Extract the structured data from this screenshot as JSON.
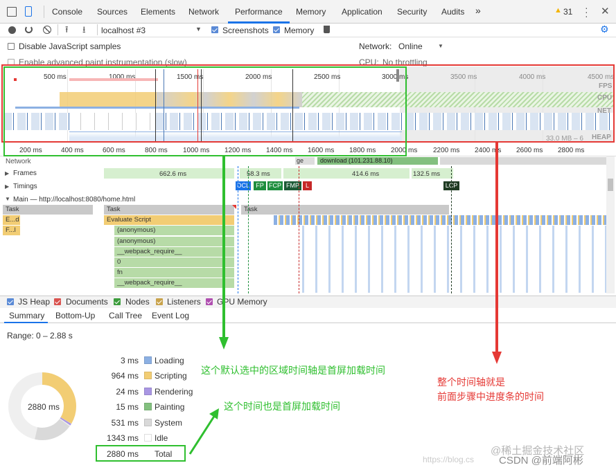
{
  "tabs": {
    "console": "Console",
    "sources": "Sources",
    "elements": "Elements",
    "network": "Network",
    "performance": "Performance",
    "memory": "Memory",
    "application": "Application",
    "security": "Security",
    "audits": "Audits",
    "more": "»",
    "warnings": "31"
  },
  "toolbar": {
    "profile_select": "localhost #3",
    "screenshots": "Screenshots",
    "memory": "Memory"
  },
  "settings": {
    "disable_js": "Disable JavaScript samples",
    "advanced_paint": "Enable advanced paint instrumentation (slow)",
    "network_label": "Network:",
    "network_value": "Online",
    "cpu_label": "CPU:",
    "cpu_value": "No throttling"
  },
  "overview": {
    "ticks": [
      "500 ms",
      "1000 ms",
      "1500 ms",
      "2000 ms",
      "2500 ms",
      "3000 ms",
      "3500 ms",
      "4000 ms",
      "4500 ms"
    ],
    "labels": {
      "fps": "FPS",
      "cpu": "CPU",
      "net": "NET",
      "heap": "HEAP"
    },
    "heap_range": "33.0 MB – 6"
  },
  "ruler": [
    "200 ms",
    "400 ms",
    "600 ms",
    "800 ms",
    "1000 ms",
    "1200 ms",
    "1400 ms",
    "1600 ms",
    "1800 ms",
    "2000 ms",
    "2200 ms",
    "2400 ms",
    "2600 ms",
    "2800 ms"
  ],
  "tracks": {
    "network": "Network",
    "frames": "Frames",
    "timings": "Timings",
    "main": "Main — http://localhost:8080/home.html",
    "network_item": "ge",
    "network_download": "download (101.231.88.10)"
  },
  "frames": [
    "662.6 ms",
    "58.3 ms",
    "414.6 ms",
    "132.5 ms"
  ],
  "timings": [
    "DCL",
    "FP",
    "FCP",
    "FMP",
    "L",
    "LCP"
  ],
  "flame": {
    "task_a": "Task",
    "task_b": "Task",
    "task_c": "Task",
    "e_d": "E...d",
    "f_l": "F...l",
    "evaluate": "Evaluate Script",
    "anon1": "(anonymous)",
    "anon2": "(anonymous)",
    "webpack1": "__webpack_require__",
    "zero": "0",
    "fn": "fn",
    "webpack2": "__webpack_require__"
  },
  "counters": {
    "js_heap": "JS Heap",
    "documents": "Documents",
    "nodes": "Nodes",
    "listeners": "Listeners",
    "gpu": "GPU Memory"
  },
  "subtabs": {
    "summary": "Summary",
    "bottom_up": "Bottom-Up",
    "call_tree": "Call Tree",
    "event_log": "Event Log"
  },
  "summary": {
    "range": "Range: 0 – 2.88 s",
    "total_center": "2880 ms",
    "rows": [
      {
        "value": "3 ms",
        "label": "Loading",
        "color": "#8cb0e3"
      },
      {
        "value": "964 ms",
        "label": "Scripting",
        "color": "#f2cd74"
      },
      {
        "value": "24 ms",
        "label": "Rendering",
        "color": "#a996e3"
      },
      {
        "value": "15 ms",
        "label": "Painting",
        "color": "#83c07f"
      },
      {
        "value": "531 ms",
        "label": "System",
        "color": "#d9d9d9"
      },
      {
        "value": "1343 ms",
        "label": "Idle",
        "color": "#ffffff"
      }
    ],
    "total_value": "2880 ms",
    "total_label": "Total"
  },
  "annotations": {
    "green1": "这个默认选中的区域时间轴是首屏加载时间",
    "green2": "这个时间也是首屏加载时间",
    "red_line1": "整个时间轴就是",
    "red_line2": "前面步骤中进度条的时间",
    "wm1": "@稀土掘金技术社区",
    "wm2": "https://blog.cs",
    "wm3": "CSDN @前端阿彬"
  },
  "colors": {
    "accent": "#1a73e8",
    "annot_red": "#e53935",
    "annot_green": "#2fbf2f"
  }
}
